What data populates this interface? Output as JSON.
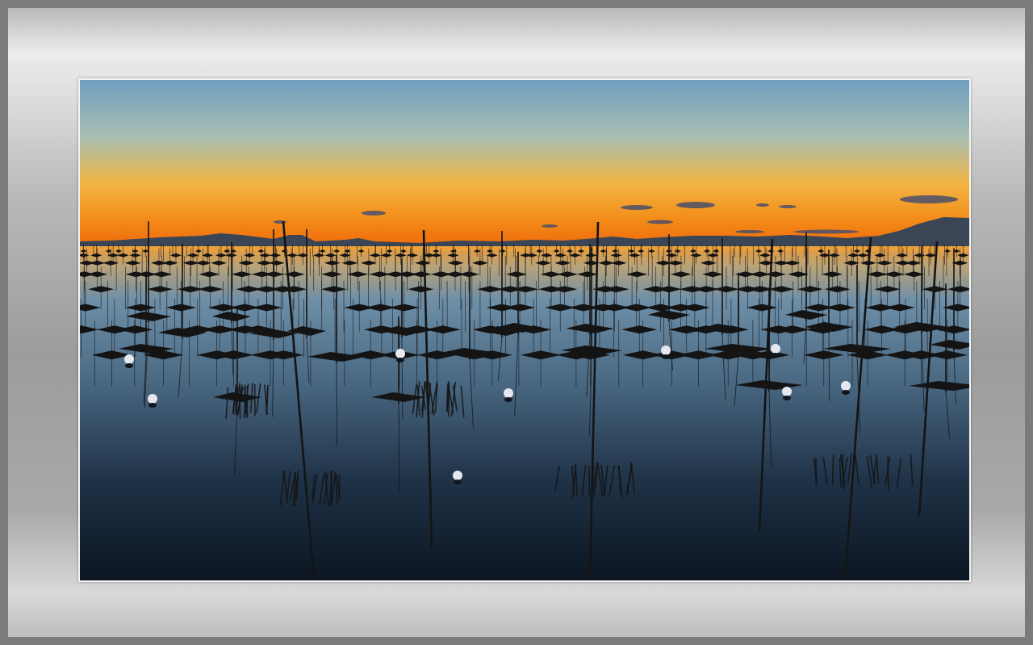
{
  "scene": {
    "subject": "seaweed-farm-at-sunset",
    "colors": {
      "sky_top": "#6f9fbf",
      "sky_mid": "#b9c6a6",
      "sky_gold": "#f0a52b",
      "horizon": "#f36c0f",
      "hills": "#3a4556",
      "water_top": "#e89a3a",
      "water_mid": "#6e8fa8",
      "water_bottom": "#0f1a28",
      "silhouette": "#141414"
    }
  }
}
